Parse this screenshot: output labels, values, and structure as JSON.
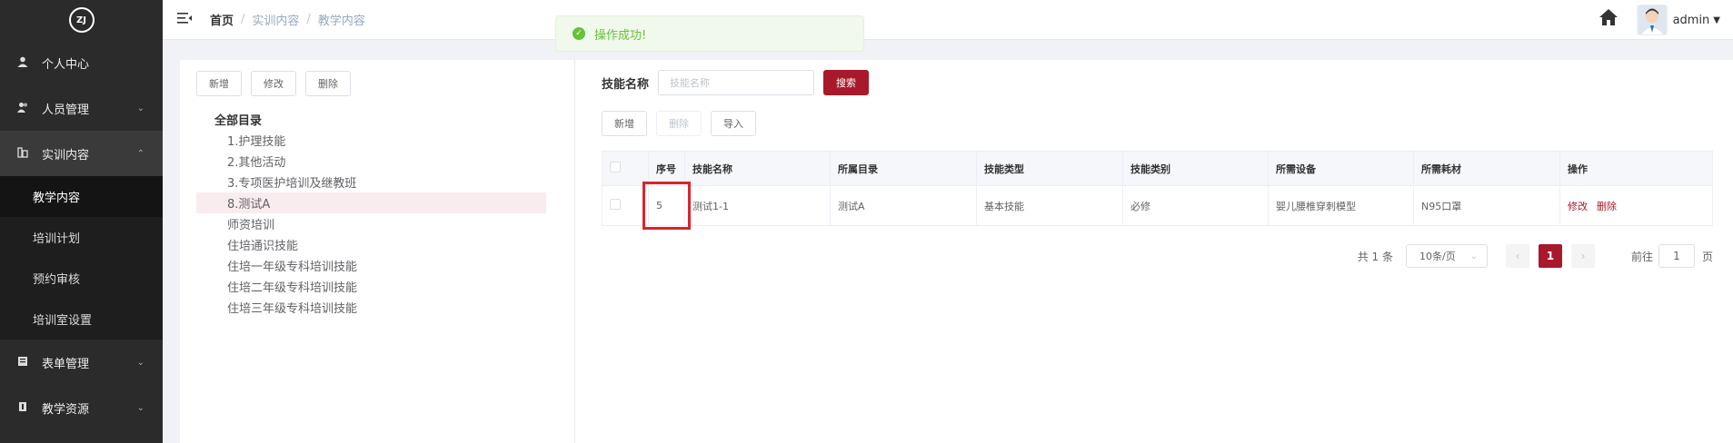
{
  "logo": {
    "text": "ZJ"
  },
  "sidebar": {
    "items": [
      {
        "label": "个人中心",
        "icon": "user-icon"
      },
      {
        "label": "人员管理",
        "icon": "users-icon"
      },
      {
        "label": "实训内容",
        "icon": "book-icon"
      },
      {
        "label": "表单管理",
        "icon": "form-icon"
      },
      {
        "label": "教学资源",
        "icon": "resource-icon"
      }
    ],
    "sub_items": [
      "教学内容",
      "培训计划",
      "预约审核",
      "培训室设置"
    ]
  },
  "header": {
    "breadcrumb": [
      "首页",
      "实训内容",
      "教学内容"
    ],
    "breadcrumb_sep": "/",
    "username": "admin"
  },
  "toast": {
    "message": "操作成功!",
    "type": "success"
  },
  "tree": {
    "buttons": [
      "新增",
      "修改",
      "删除"
    ],
    "root": "全部目录",
    "nodes": [
      "1.护理技能",
      "2.其他活动",
      "3.专项医护培训及继教班",
      "8.测试A",
      "师资培训",
      "住培通识技能",
      "住培一年级专科培训技能",
      "住培二年级专科培训技能",
      "住培三年级专科培训技能"
    ],
    "selected_index": 3
  },
  "search": {
    "label": "技能名称",
    "placeholder": "技能名称",
    "button": "搜索"
  },
  "toolbar": {
    "add": "新增",
    "delete": "删除",
    "import": "导入"
  },
  "table": {
    "headers": [
      "序号",
      "技能名称",
      "所属目录",
      "技能类型",
      "技能类别",
      "所需设备",
      "所需耗材",
      "操作"
    ],
    "rows": [
      {
        "index": "5",
        "name": "测试1-1",
        "dir": "测试A",
        "type": "基本技能",
        "category": "必修",
        "device": "婴儿腰椎穿刺模型",
        "consumable": "N95口罩",
        "edit": "修改",
        "delete": "删除"
      }
    ]
  },
  "pager": {
    "total": "共 1 条",
    "page_size": "10条/页",
    "current": "1",
    "goto_label": "前往",
    "goto_value": "1",
    "page_unit": "页"
  },
  "colors": {
    "brand": "#a8192b",
    "sidebar": "#2b2b2b",
    "success": "#67c23a",
    "highlight": "#d7262e"
  }
}
